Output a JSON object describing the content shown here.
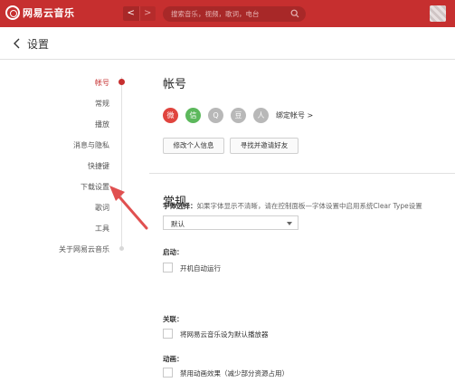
{
  "app": {
    "logo_text": "网易云音乐",
    "search_placeholder": "搜索音乐，视频，歌词，电台",
    "back_arrow": "<",
    "forward_arrow": ">"
  },
  "header": {
    "title": "设置"
  },
  "sidebar": {
    "items": [
      {
        "label": "帐号",
        "active": true
      },
      {
        "label": "常规"
      },
      {
        "label": "播放"
      },
      {
        "label": "消息与隐私"
      },
      {
        "label": "快捷键"
      },
      {
        "label": "下载设置"
      },
      {
        "label": "歌词"
      },
      {
        "label": "工具"
      },
      {
        "label": "关于网易云音乐"
      }
    ]
  },
  "account": {
    "title": "帐号",
    "bind_link": "绑定帐号 >",
    "edit_profile_button": "修改个人信息",
    "find_friends_button": "寻找并邀请好友",
    "social_icons": [
      "weibo-icon",
      "wechat-icon",
      "qq-icon",
      "douban-icon",
      "renren-icon"
    ]
  },
  "general": {
    "title": "常规",
    "font_label": "字体选择：",
    "font_hint": "如果字体显示不清晰，请在控制面板—字体设置中启用系统Clear Type设置",
    "font_value": "默认",
    "startup_label": "启动：",
    "startup_option": "开机自动运行",
    "assoc_label": "关联：",
    "assoc_option": "将网易云音乐设为默认播放器",
    "anim_label": "动画：",
    "anim_option": "禁用动画效果（减少部分资源占用）"
  },
  "colors": {
    "brand": "#c62f2f",
    "annotation": "#e05050"
  }
}
